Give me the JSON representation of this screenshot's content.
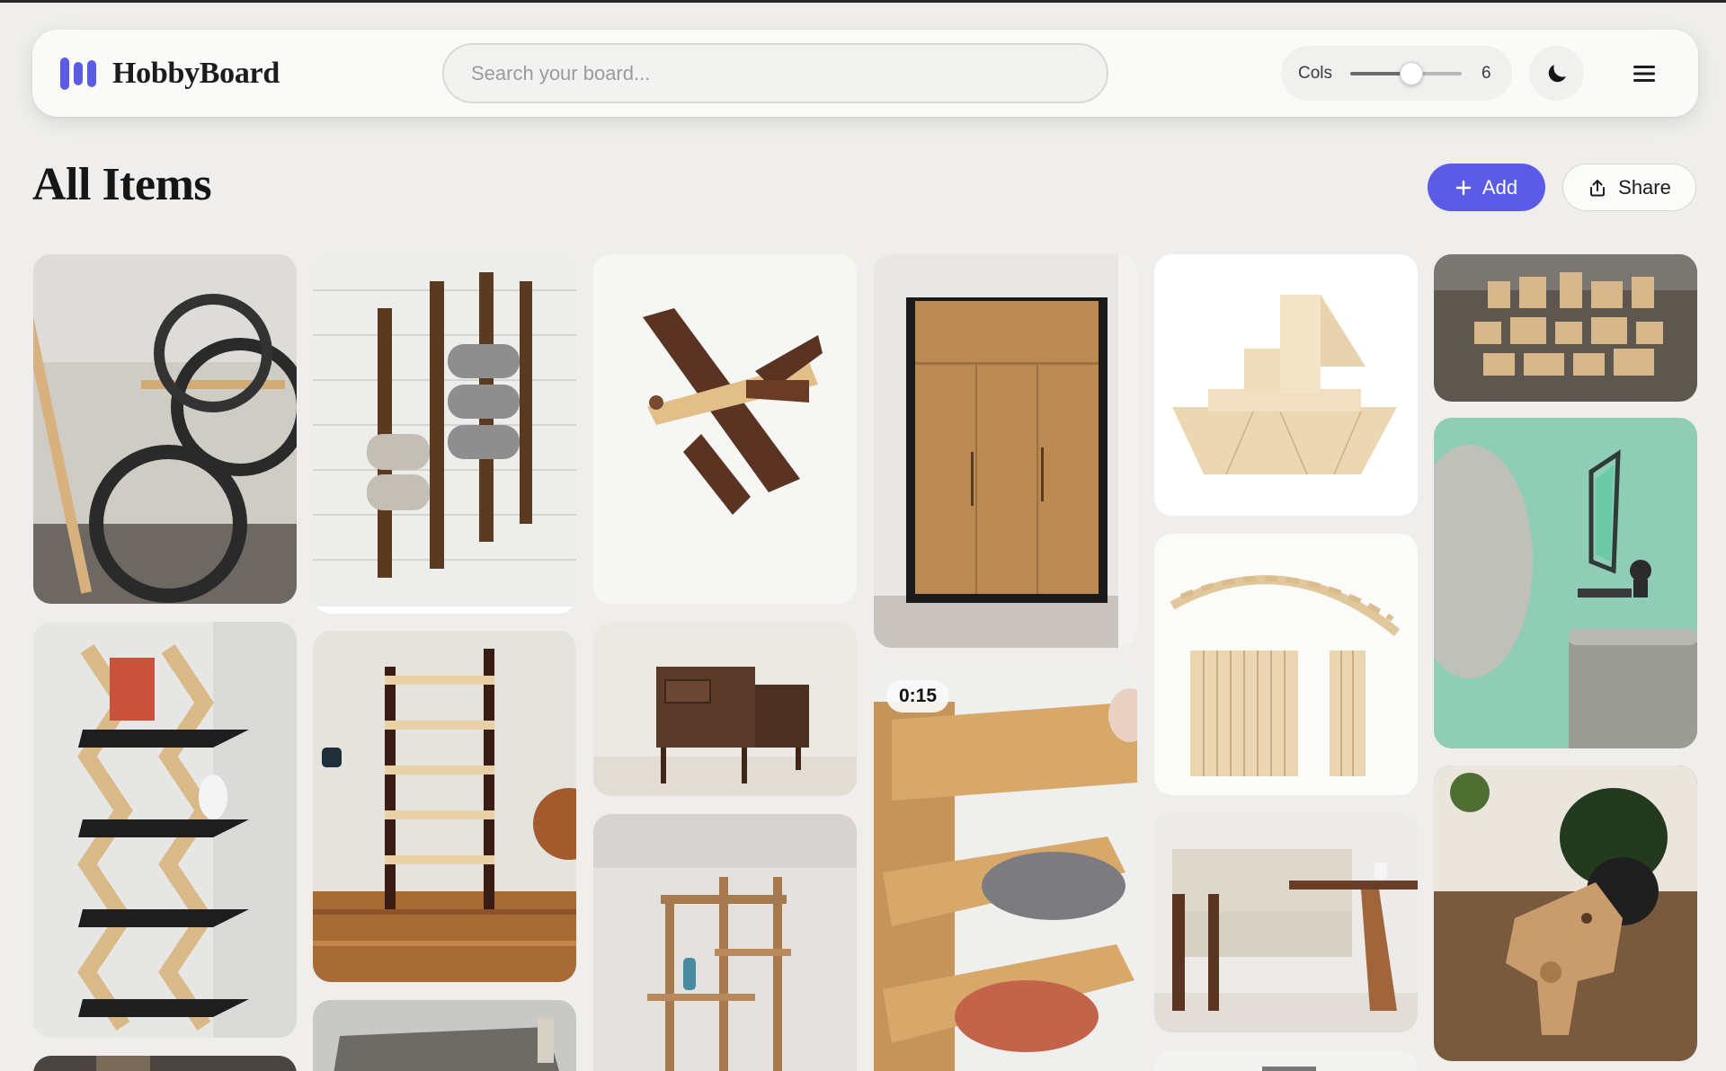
{
  "app": {
    "name": "HobbyBoard"
  },
  "search": {
    "placeholder": "Search your board..."
  },
  "columns": {
    "label": "Cols",
    "value": "6",
    "slider_fraction": 0.55
  },
  "page": {
    "title": "All Items"
  },
  "actions": {
    "add_label": "Add",
    "share_label": "Share"
  },
  "icons": {
    "logo": "bars-logo-icon",
    "theme": "moon-icon",
    "menu": "hamburger-menu-icon",
    "add": "plus-icon",
    "share": "share-upload-icon"
  },
  "colors": {
    "accent": "#5b5be6",
    "background": "#efeeec",
    "header": "#fafaf9"
  },
  "items": [
    {
      "name": "bike-rack-photo",
      "badge": ""
    },
    {
      "name": "towel-rack-photo",
      "badge": ""
    },
    {
      "name": "wooden-airplane-photo",
      "badge": ""
    },
    {
      "name": "wardrobe-photo",
      "badge": ""
    },
    {
      "name": "block-boat-photo",
      "badge": ""
    },
    {
      "name": "wood-blocks-photo",
      "badge": ""
    },
    {
      "name": "zigzag-shelf-photo",
      "badge": ""
    },
    {
      "name": "bookshelf-photo",
      "badge": ""
    },
    {
      "name": "nightstands-photo",
      "badge": ""
    },
    {
      "name": "shoe-rack-video",
      "badge": "0:15"
    },
    {
      "name": "stick-bridge-photo",
      "badge": ""
    },
    {
      "name": "crystal-lamp-photo",
      "badge": ""
    },
    {
      "name": "ladder-shelf-photo",
      "badge": ""
    },
    {
      "name": "sofa-table-photo",
      "badge": ""
    },
    {
      "name": "wooden-dinosaur-photo",
      "badge": ""
    },
    {
      "name": "desk-photo",
      "badge": ""
    },
    {
      "name": "partial-photo-col1",
      "badge": ""
    },
    {
      "name": "partial-photo-col5",
      "badge": ""
    }
  ]
}
